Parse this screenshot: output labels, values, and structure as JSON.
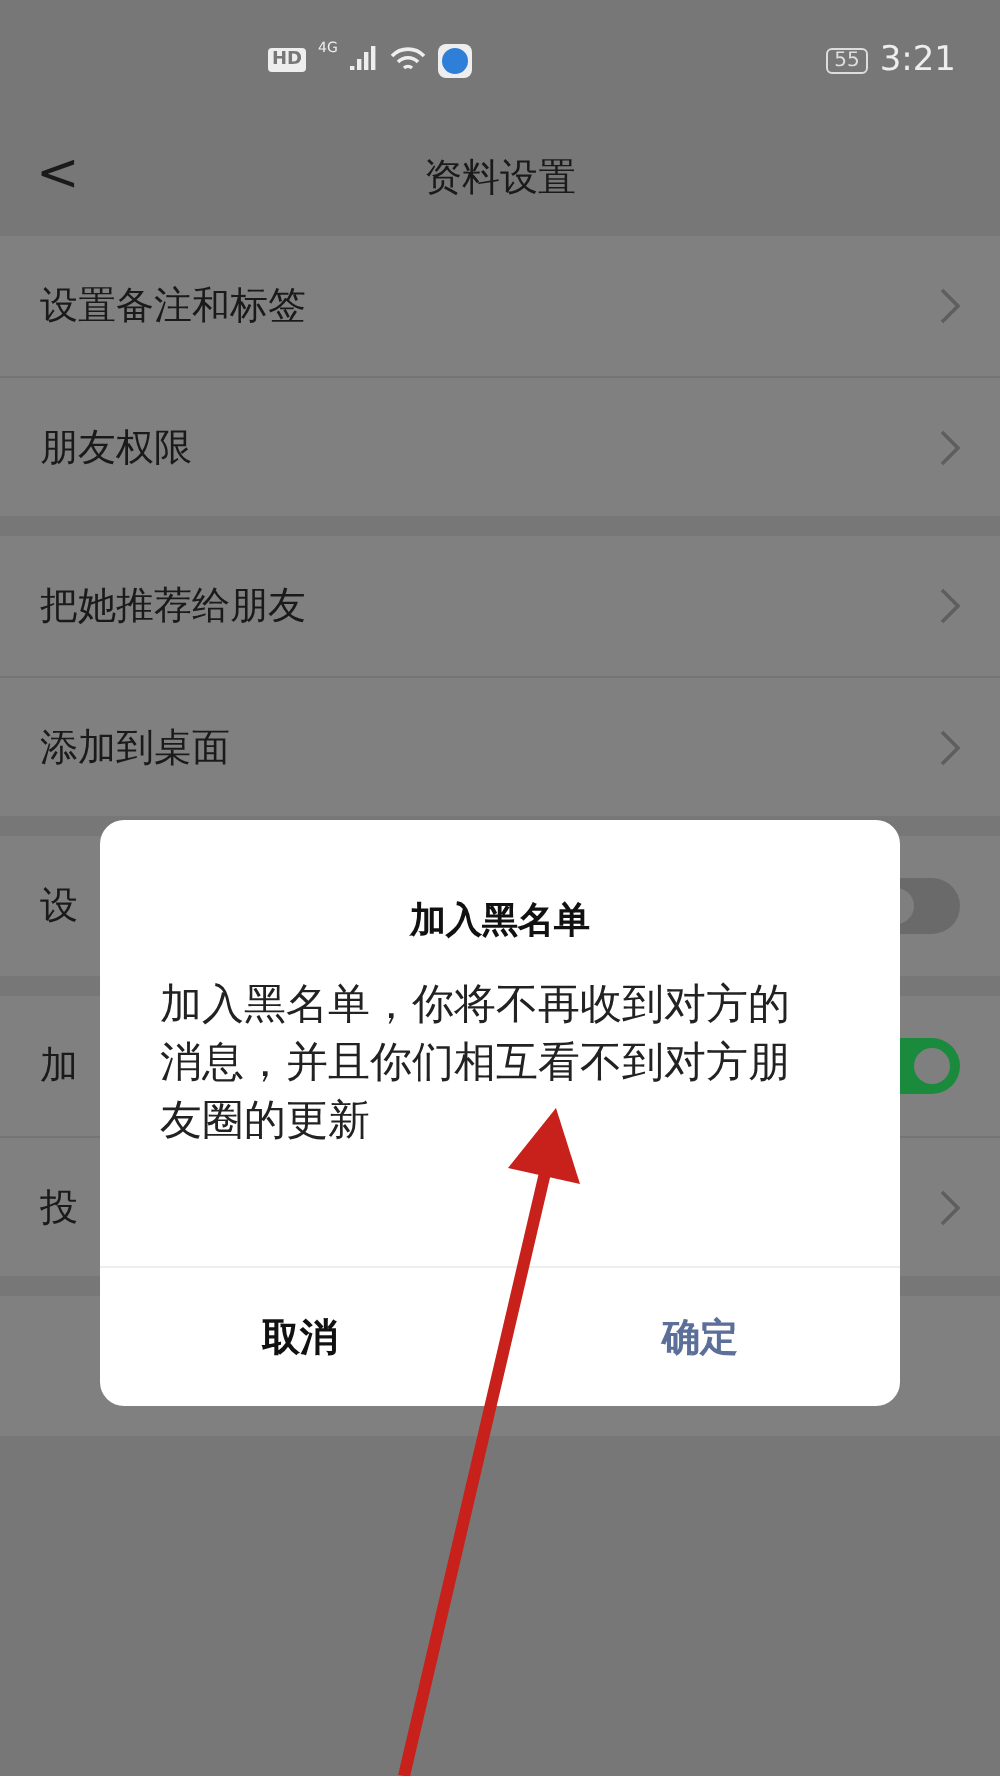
{
  "status_bar": {
    "hd": "HD",
    "network": "4G",
    "battery": "55",
    "time": "3:21"
  },
  "nav": {
    "back": "<",
    "title": "资料设置"
  },
  "groups": [
    {
      "items": [
        {
          "kind": "link",
          "label": "设置备注和标签"
        },
        {
          "kind": "link",
          "label": "朋友权限"
        }
      ]
    },
    {
      "items": [
        {
          "kind": "link",
          "label": "把她推荐给朋友"
        },
        {
          "kind": "link",
          "label": "添加到桌面"
        }
      ]
    },
    {
      "items": [
        {
          "kind": "toggle",
          "label": "设",
          "on": false
        }
      ]
    },
    {
      "items": [
        {
          "kind": "toggle",
          "label": "加",
          "on": true
        },
        {
          "kind": "link",
          "label": "投"
        }
      ]
    },
    {
      "items": [
        {
          "kind": "blank"
        }
      ]
    }
  ],
  "dialog": {
    "title": "加入黑名单",
    "message": "加入黑名单，你将不再收到对方的消息，并且你们相互看不到对方朋友圈的更新",
    "buttons": [
      {
        "kind": "cancel",
        "label": "取消"
      },
      {
        "kind": "confirm",
        "label": "确定"
      }
    ]
  }
}
